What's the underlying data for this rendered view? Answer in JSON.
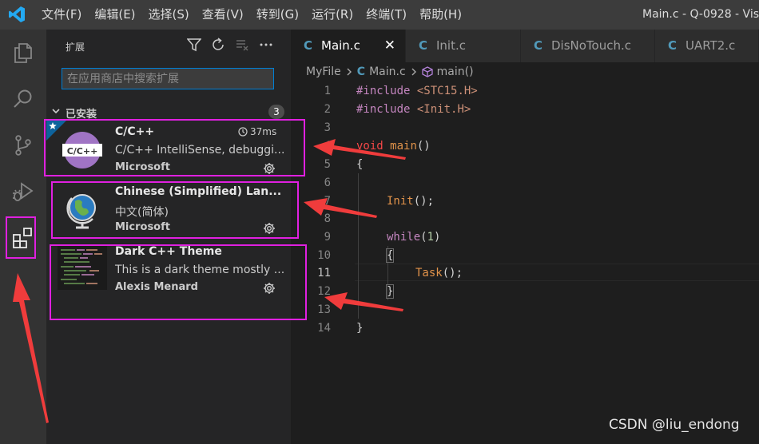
{
  "menu": [
    "文件(F)",
    "编辑(E)",
    "选择(S)",
    "查看(V)",
    "转到(G)",
    "运行(R)",
    "终端(T)",
    "帮助(H)"
  ],
  "window_title": "Main.c - Q-0928 - Vis",
  "sidebar": {
    "title": "扩展",
    "search_placeholder": "在应用商店中搜索扩展",
    "section_label": "已安装",
    "section_count": "3",
    "extensions": [
      {
        "name": "C/C++",
        "desc": "C/C++ IntelliSense, debuggi...",
        "publisher": "Microsoft",
        "timing": "37ms",
        "icon_text": "C/C++"
      },
      {
        "name": "Chinese (Simplified) Lan...",
        "desc": "中文(简体)",
        "publisher": "Microsoft"
      },
      {
        "name": "Dark C++ Theme",
        "desc": "This is a dark theme mostly ...",
        "publisher": "Alexis Menard"
      }
    ]
  },
  "tabs": [
    {
      "label": "Main.c",
      "active": true
    },
    {
      "label": "Init.c"
    },
    {
      "label": "DisNoTouch.c"
    },
    {
      "label": "UART2.c"
    }
  ],
  "breadcrumb": {
    "folder": "MyFile",
    "file": "Main.c",
    "symbol": "main()"
  },
  "editor": {
    "line_numbers": [
      "1",
      "2",
      "3",
      "4",
      "5",
      "6",
      "7",
      "8",
      "9",
      "10",
      "11",
      "12",
      "13",
      "14"
    ],
    "current_line": "11",
    "tokens": {
      "include": "#include",
      "header1": "<STC15.H>",
      "header2": "<Init.H>",
      "void": "void",
      "main": "main",
      "parens": "()",
      "open_brace": "{",
      "close_brace": "}",
      "init_call": "Init",
      "call_end": "();",
      "while": "while",
      "paren_open": "(",
      "one": "1",
      "paren_close": ")",
      "task_call": "Task"
    }
  },
  "watermark": "CSDN @liu_endong",
  "colors": {
    "highlight": "#e020e0",
    "arrow": "#f03c3c",
    "accent": "#007fd4"
  },
  "icons": [
    "vscode-logo-icon",
    "explorer-icon",
    "search-icon",
    "source-control-icon",
    "run-debug-icon",
    "extensions-icon",
    "filter-icon",
    "refresh-icon",
    "clear-icon",
    "more-icon",
    "chevron-down-icon",
    "gear-icon",
    "clock-icon",
    "globe-icon",
    "c-file-icon",
    "close-icon",
    "cube-icon",
    "star-icon"
  ]
}
